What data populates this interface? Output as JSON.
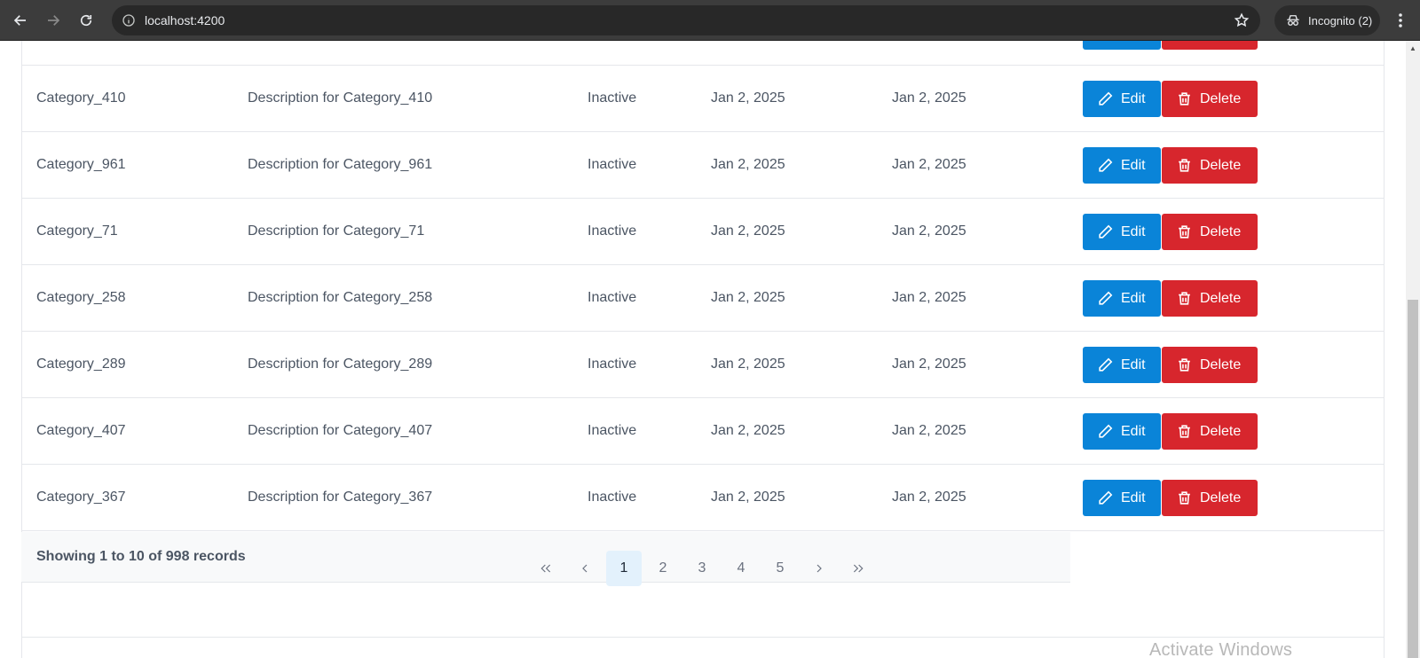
{
  "browser": {
    "url": "localhost:4200",
    "incognito_label": "Incognito (2)"
  },
  "table": {
    "edit_label": "Edit",
    "delete_label": "Delete",
    "rows": [
      {
        "name": "Category_410",
        "description": "Description for Category_410",
        "status": "Inactive",
        "created": "Jan 2, 2025",
        "updated": "Jan 2, 2025"
      },
      {
        "name": "Category_961",
        "description": "Description for Category_961",
        "status": "Inactive",
        "created": "Jan 2, 2025",
        "updated": "Jan 2, 2025"
      },
      {
        "name": "Category_71",
        "description": "Description for Category_71",
        "status": "Inactive",
        "created": "Jan 2, 2025",
        "updated": "Jan 2, 2025"
      },
      {
        "name": "Category_258",
        "description": "Description for Category_258",
        "status": "Inactive",
        "created": "Jan 2, 2025",
        "updated": "Jan 2, 2025"
      },
      {
        "name": "Category_289",
        "description": "Description for Category_289",
        "status": "Inactive",
        "created": "Jan 2, 2025",
        "updated": "Jan 2, 2025"
      },
      {
        "name": "Category_407",
        "description": "Description for Category_407",
        "status": "Inactive",
        "created": "Jan 2, 2025",
        "updated": "Jan 2, 2025"
      },
      {
        "name": "Category_367",
        "description": "Description for Category_367",
        "status": "Inactive",
        "created": "Jan 2, 2025",
        "updated": "Jan 2, 2025"
      }
    ]
  },
  "footer": {
    "summary": "Showing 1 to 10 of 998 records"
  },
  "pagination": {
    "pages": [
      "1",
      "2",
      "3",
      "4",
      "5"
    ],
    "active_page": "1"
  },
  "watermark": "Activate Windows",
  "colors": {
    "edit": "#0a84d8",
    "delete": "#d7262d",
    "active_page_bg": "#e3f1fc"
  }
}
